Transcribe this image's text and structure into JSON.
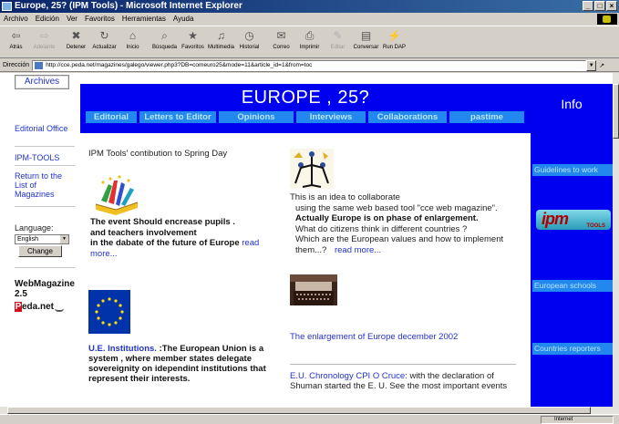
{
  "window": {
    "title": "Europe, 25? (IPM Tools) - Microsoft Internet Explorer",
    "controls": [
      "_",
      "□",
      "×"
    ]
  },
  "menu": [
    "Archivo",
    "Edición",
    "Ver",
    "Favoritos",
    "Herramientas",
    "Ayuda"
  ],
  "toolbar": [
    {
      "label": "Atrás",
      "icon": "back-arrow-icon",
      "glyph": "⇦",
      "disabled": false
    },
    {
      "label": "Adelante",
      "icon": "forward-arrow-icon",
      "glyph": "⇨",
      "disabled": true
    },
    {
      "label": "Detener",
      "icon": "stop-icon",
      "glyph": "✖",
      "disabled": false
    },
    {
      "label": "Actualizar",
      "icon": "refresh-icon",
      "glyph": "↻",
      "disabled": false
    },
    {
      "label": "Inicio",
      "icon": "home-icon",
      "glyph": "⌂",
      "disabled": false
    },
    {
      "label": "Búsqueda",
      "icon": "search-icon",
      "glyph": "⌕",
      "disabled": false
    },
    {
      "label": "Favoritos",
      "icon": "favorites-icon",
      "glyph": "★",
      "disabled": false
    },
    {
      "label": "Multimedia",
      "icon": "media-icon",
      "glyph": "♫",
      "disabled": false
    },
    {
      "label": "Historial",
      "icon": "history-icon",
      "glyph": "◷",
      "disabled": false
    },
    {
      "label": "Correo",
      "icon": "mail-icon",
      "glyph": "✉",
      "disabled": false
    },
    {
      "label": "Imprimir",
      "icon": "print-icon",
      "glyph": "⎙",
      "disabled": false
    },
    {
      "label": "Editar",
      "icon": "edit-icon",
      "glyph": "✎",
      "disabled": true
    },
    {
      "label": "Conversar",
      "icon": "discuss-icon",
      "glyph": "▤",
      "disabled": false
    },
    {
      "label": "Run DAP",
      "icon": "run-dap-icon",
      "glyph": "⚡",
      "disabled": false
    }
  ],
  "address": {
    "label": "Dirección",
    "url": "http://cce.peda.net/magazines/galego/viewer.php3?DB=comeuro25&mode=11&article_id=1&from=toc",
    "go": "↗"
  },
  "left": {
    "archives": "Archives",
    "nav": [
      {
        "label": "Editorial Office"
      },
      {
        "label": "IPM-TOOLS"
      },
      {
        "label": "Return to the List of Magazines"
      }
    ],
    "language_label": "Language:",
    "language_value": "English",
    "change": "Change",
    "webmagazine": "WebMagazine 2.5",
    "peda_logo": "Peda.net"
  },
  "banner": {
    "title": "EUROPE , 25?",
    "tabs": [
      "Editorial",
      "Letters to Editor",
      "Opinions",
      "Interviews",
      "Collaborations",
      "pastime"
    ]
  },
  "right": {
    "title": "Info",
    "links": [
      "Guidelines to work",
      "European schools",
      "Countries reporters"
    ],
    "ipm_logo_text": "ipm",
    "ipm_logo_sub": "TOOLS"
  },
  "main": {
    "ipm_intro": "IPM Tools' contibution to  Spring Day",
    "event_line1": "The event Should encrease pupils .",
    "event_line2": "and teachers involvement",
    "event_line3": "in the dabate of the future of Europe",
    "event_read_more": "read more...",
    "ue_link": "U.E. Institutions.",
    "ue_text": " :The European Union is a system , where member states delegate sovereignity on idependint institutions that represent their interests.",
    "collab_line1": "This is an idea to collaborate",
    "collab_line2": "using the same web based tool \"cce web magazine\".",
    "collab_line3": "Actually Europe is on phase of enlargement.",
    "collab_line4": "What do citizens think in different countries ?",
    "collab_line5": "Which are the European values and how  to implement them...?",
    "collab_read_more": "read more...",
    "enlarge_link": "The enlargement of Europe december 2002",
    "chrono_link": "E.U. Chronology CPI O Cruce:",
    "chrono_text": " with the declaration of Shuman started the E. U. See the most important events"
  },
  "status": {
    "zone": "Internet"
  },
  "colors": {
    "banner_blue": "#0000f0",
    "tab_blue": "#2288f0",
    "tab_text": "#b8e6ff",
    "link": "#2233cc"
  }
}
